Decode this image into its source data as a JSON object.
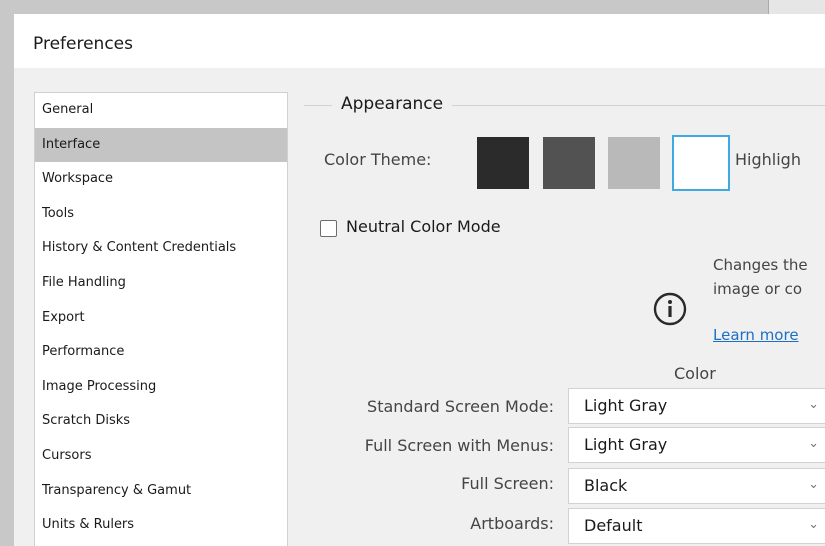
{
  "window": {
    "title": "Preferences"
  },
  "sidebar": {
    "items": [
      {
        "label": "General",
        "selected": false
      },
      {
        "label": "Interface",
        "selected": true
      },
      {
        "label": "Workspace",
        "selected": false
      },
      {
        "label": "Tools",
        "selected": false
      },
      {
        "label": "History & Content Credentials",
        "selected": false
      },
      {
        "label": "File Handling",
        "selected": false
      },
      {
        "label": "Export",
        "selected": false
      },
      {
        "label": "Performance",
        "selected": false
      },
      {
        "label": "Image Processing",
        "selected": false
      },
      {
        "label": "Scratch Disks",
        "selected": false
      },
      {
        "label": "Cursors",
        "selected": false
      },
      {
        "label": "Transparency & Gamut",
        "selected": false
      },
      {
        "label": "Units & Rulers",
        "selected": false
      }
    ]
  },
  "appearance": {
    "section_title": "Appearance",
    "color_theme_label": "Color Theme:",
    "themes": [
      {
        "color": "#2b2b2b",
        "selected": false
      },
      {
        "color": "#525252",
        "selected": false
      },
      {
        "color": "#b9b9b9",
        "selected": false
      },
      {
        "color": "#ffffff",
        "selected": true
      }
    ],
    "highlight_label": "Highligh",
    "neutral_color_mode": {
      "label": "Neutral Color Mode",
      "checked": false
    },
    "info": {
      "line1": "Changes the",
      "line2": "image or co",
      "learn_more": "Learn more"
    },
    "color_heading": "Color",
    "rows": [
      {
        "label": "Standard Screen Mode:",
        "value": "Light Gray"
      },
      {
        "label": "Full Screen with Menus:",
        "value": "Light Gray"
      },
      {
        "label": "Full Screen:",
        "value": "Black"
      },
      {
        "label": "Artboards:",
        "value": "Default"
      }
    ]
  },
  "colors": {
    "accent": "#3fa9e0",
    "link": "#1c6fc7",
    "selected_item_bg": "#c4c4c4"
  }
}
